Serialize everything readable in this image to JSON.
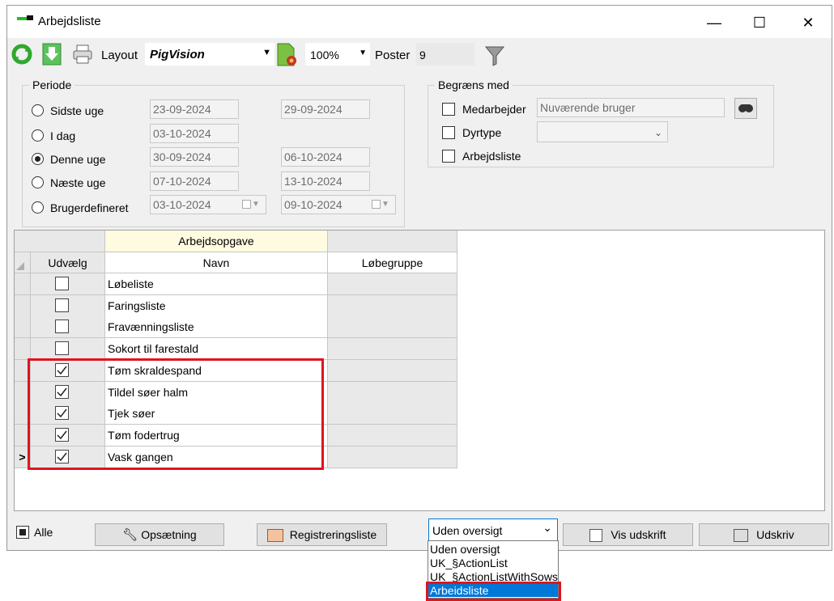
{
  "window": {
    "title": "Arbejdsliste",
    "minimize": "—",
    "maximize": "☐",
    "close": "✕"
  },
  "toolbar": {
    "layout_label": "Layout",
    "layout_value": "PigVision",
    "zoom_value": "100%",
    "poster_label": "Poster",
    "poster_value": "9"
  },
  "periode": {
    "title": "Periode",
    "options": [
      {
        "label": "Sidste uge",
        "from": "23-09-2024",
        "to": "29-09-2024",
        "selected": false
      },
      {
        "label": "I dag",
        "from": "03-10-2024",
        "to": "",
        "selected": false
      },
      {
        "label": "Denne uge",
        "from": "30-09-2024",
        "to": "06-10-2024",
        "selected": true
      },
      {
        "label": "Næste uge",
        "from": "07-10-2024",
        "to": "13-10-2024",
        "selected": false
      },
      {
        "label": "Brugerdefineret",
        "from": "03-10-2024",
        "to": "09-10-2024",
        "selected": false
      }
    ]
  },
  "begraens": {
    "title": "Begræns med",
    "medarbejder_label": "Medarbejder",
    "medarbejder_value": "Nuværende bruger",
    "dyrtype_label": "Dyrtype",
    "dyrtype_value": "",
    "arbejdsliste_label": "Arbejdsliste"
  },
  "grid": {
    "band_header": "Arbejdsopgave",
    "col_select": "Udvælg",
    "col_name": "Navn",
    "col_group": "Løbegruppe",
    "current_row_marker": ">",
    "rows": [
      {
        "name": "Løbeliste",
        "checked": false
      },
      {
        "name": "Faringsliste",
        "checked": false
      },
      {
        "name": "Fravænningsliste",
        "checked": false
      },
      {
        "name": "Sokort til farestald",
        "checked": false
      },
      {
        "name": "Tøm skraldespand",
        "checked": true
      },
      {
        "name": "Tildel søer halm",
        "checked": true
      },
      {
        "name": "Tjek søer",
        "checked": true
      },
      {
        "name": "Tøm fodertrug",
        "checked": true
      },
      {
        "name": "Vask gangen",
        "checked": true
      }
    ]
  },
  "footer": {
    "alle_label": "Alle",
    "opsaetning_label": "Opsætning",
    "registrering_label": "Registreringsliste",
    "oversigt_value": "Uden oversigt",
    "vis_udskrift_label": "Vis udskrift",
    "udskriv_label": "Udskriv"
  },
  "oversigt_options": [
    "Uden oversigt",
    "UK_§ActionList",
    "UK_§ActionListWithSows",
    "Arbeidsliste"
  ],
  "colors": {
    "highlight": "#e0141e",
    "selection": "#0078d7"
  }
}
